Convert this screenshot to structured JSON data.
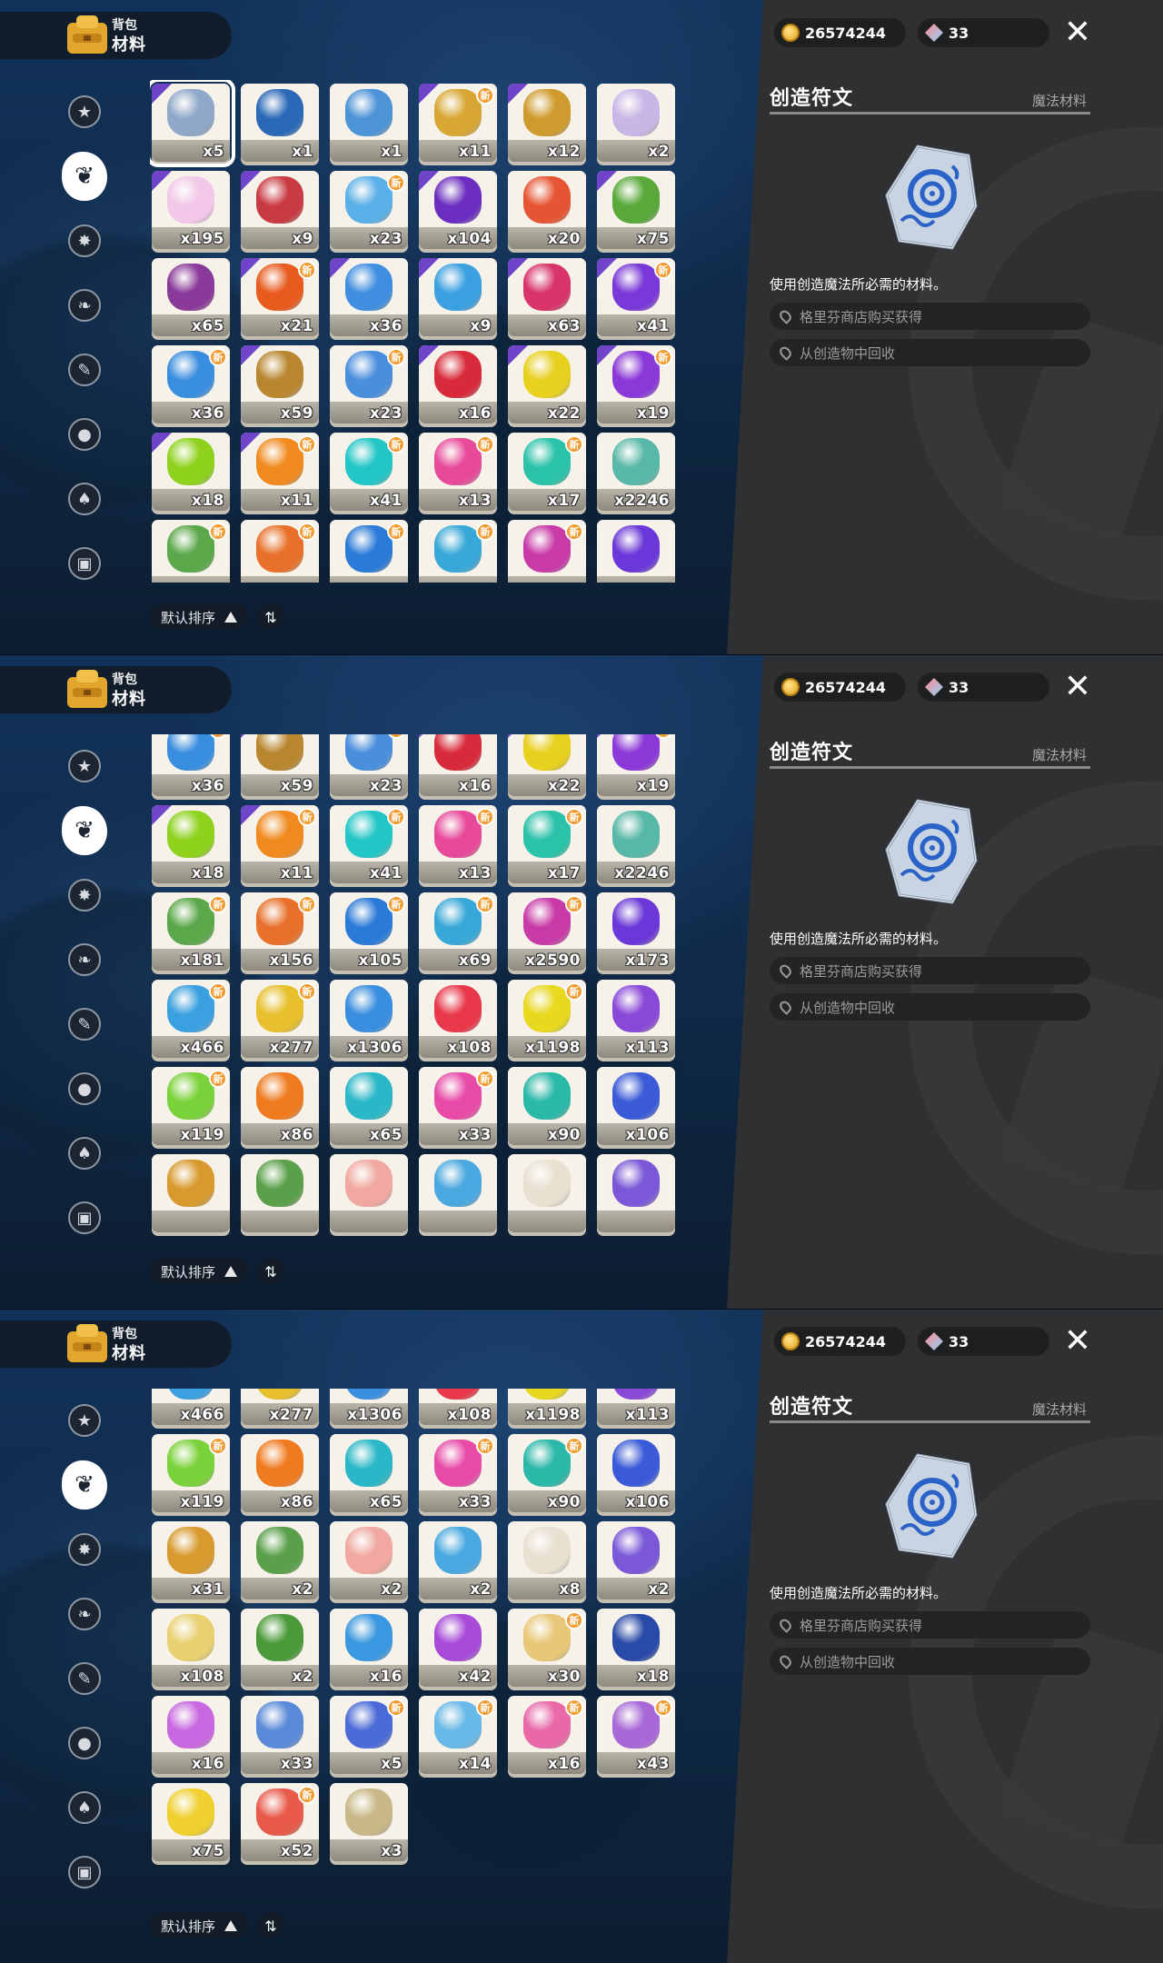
{
  "header": {
    "title_small": "背包",
    "title_big": "材料"
  },
  "currency": {
    "coins": "26574244",
    "gems": "33"
  },
  "detail": {
    "name": "创造符文",
    "category": "魔法材料",
    "description": "使用创造魔法所必需的材料。",
    "sources": [
      "格里芬商店购买获得",
      "从创造物中回收"
    ]
  },
  "sort": {
    "label": "默认排序"
  },
  "categories": [
    "star-tab",
    "material-tab",
    "magic-tab",
    "plant-tab",
    "book-tab",
    "ball-tab",
    "acorn-tab",
    "furniture-tab"
  ],
  "panels": [
    {
      "rows": [
        [
          {
            "q": "x5",
            "c": "#8fa7c8",
            "sel": true,
            "corner": true
          },
          {
            "q": "x1",
            "c": "#2a68b8"
          },
          {
            "q": "x1",
            "c": "#4d93d8"
          },
          {
            "q": "x11",
            "c": "#d8a733",
            "corner": true,
            "new": true
          },
          {
            "q": "x12",
            "c": "#cf9b2e",
            "corner": true
          },
          {
            "q": "x2",
            "c": "#c8b6e6"
          }
        ],
        [
          {
            "q": "x195",
            "c": "#f2c7e8",
            "corner": true
          },
          {
            "q": "x9",
            "c": "#c93a42",
            "corner": true
          },
          {
            "q": "x23",
            "c": "#5ab0e8",
            "new": true
          },
          {
            "q": "x104",
            "c": "#6b2ec0",
            "corner": true
          },
          {
            "q": "x20",
            "c": "#e65533"
          },
          {
            "q": "x75",
            "c": "#58a83a",
            "corner": true
          }
        ],
        [
          {
            "q": "x65",
            "c": "#8a3a9a"
          },
          {
            "q": "x21",
            "c": "#e85a1e",
            "corner": true,
            "new": true
          },
          {
            "q": "x36",
            "c": "#3f8ee0",
            "corner": true
          },
          {
            "q": "x9",
            "c": "#3aa0e0",
            "corner": true
          },
          {
            "q": "x63",
            "c": "#d8346a",
            "corner": true
          },
          {
            "q": "x41",
            "c": "#7a38d8",
            "corner": true,
            "new": true
          }
        ],
        [
          {
            "q": "x36",
            "c": "#3a8ee0",
            "new": true
          },
          {
            "q": "x59",
            "c": "#b8862e",
            "corner": true
          },
          {
            "q": "x23",
            "c": "#4a8ede",
            "new": true
          },
          {
            "q": "x16",
            "c": "#d82a3a",
            "corner": true
          },
          {
            "q": "x22",
            "c": "#e8d01e",
            "corner": true
          },
          {
            "q": "x19",
            "c": "#8a38d8",
            "corner": true,
            "new": true
          }
        ],
        [
          {
            "q": "x18",
            "c": "#8ed21e",
            "corner": true
          },
          {
            "q": "x11",
            "c": "#f08a1e",
            "corner": true,
            "new": true
          },
          {
            "q": "x41",
            "c": "#22c6c6",
            "new": true
          },
          {
            "q": "x13",
            "c": "#e84a9a",
            "new": true
          },
          {
            "q": "x17",
            "c": "#2ac2a8",
            "new": true
          },
          {
            "q": "x2246",
            "c": "#58b8a8"
          }
        ],
        [
          {
            "q": "",
            "c": "#5aa84a",
            "new": true
          },
          {
            "q": "",
            "c": "#e8702a",
            "new": true
          },
          {
            "q": "",
            "c": "#2a7ad8",
            "new": true
          },
          {
            "q": "",
            "c": "#38a8d8",
            "new": true
          },
          {
            "q": "",
            "c": "#c83aa8",
            "new": true
          },
          {
            "q": "",
            "c": "#6a38d8"
          }
        ]
      ]
    },
    {
      "rows": [
        [
          {
            "q": "x36",
            "c": "#3a8ee0",
            "new": true
          },
          {
            "q": "x59",
            "c": "#b8862e",
            "corner": true
          },
          {
            "q": "x23",
            "c": "#4a8ede",
            "new": true
          },
          {
            "q": "x16",
            "c": "#d82a3a",
            "corner": true
          },
          {
            "q": "x22",
            "c": "#e8d01e",
            "corner": true
          },
          {
            "q": "x19",
            "c": "#8a38d8",
            "corner": true,
            "new": true
          }
        ],
        [
          {
            "q": "x18",
            "c": "#8ed21e",
            "corner": true
          },
          {
            "q": "x11",
            "c": "#f08a1e",
            "corner": true,
            "new": true
          },
          {
            "q": "x41",
            "c": "#22c6c6",
            "new": true
          },
          {
            "q": "x13",
            "c": "#e84a9a",
            "new": true
          },
          {
            "q": "x17",
            "c": "#2ac2a8",
            "new": true
          },
          {
            "q": "x2246",
            "c": "#58b8a8"
          }
        ],
        [
          {
            "q": "x181",
            "c": "#5aa84a",
            "new": true
          },
          {
            "q": "x156",
            "c": "#e8702a",
            "new": true
          },
          {
            "q": "x105",
            "c": "#2a7ad8",
            "new": true
          },
          {
            "q": "x69",
            "c": "#38a8d8",
            "new": true
          },
          {
            "q": "x2590",
            "c": "#c83aa8",
            "new": true
          },
          {
            "q": "x173",
            "c": "#6a38d8"
          }
        ],
        [
          {
            "q": "x466",
            "c": "#3aa0e0",
            "new": true
          },
          {
            "q": "x277",
            "c": "#e8c02e",
            "new": true
          },
          {
            "q": "x1306",
            "c": "#3a8ee0"
          },
          {
            "q": "x108",
            "c": "#e8384a"
          },
          {
            "q": "x1198",
            "c": "#e8d81e",
            "new": true
          },
          {
            "q": "x113",
            "c": "#8a48d8"
          }
        ],
        [
          {
            "q": "x119",
            "c": "#7ad23a",
            "new": true
          },
          {
            "q": "x86",
            "c": "#f07a1e"
          },
          {
            "q": "x65",
            "c": "#2ab8c8"
          },
          {
            "q": "x33",
            "c": "#e84aa8",
            "new": true
          },
          {
            "q": "x90",
            "c": "#2ab8a8"
          },
          {
            "q": "x106",
            "c": "#3a5ad8"
          }
        ],
        [
          {
            "q": "",
            "c": "#d89a2e"
          },
          {
            "q": "",
            "c": "#5aa04a"
          },
          {
            "q": "",
            "c": "#f0a8a0"
          },
          {
            "q": "",
            "c": "#4aa8e0"
          },
          {
            "q": "",
            "c": "#e8e0d0"
          },
          {
            "q": "",
            "c": "#7a58d8"
          }
        ]
      ]
    },
    {
      "rows": [
        [
          {
            "q": "x466",
            "c": "#3aa0e0"
          },
          {
            "q": "x277",
            "c": "#e8c02e"
          },
          {
            "q": "x1306",
            "c": "#3a8ee0"
          },
          {
            "q": "x108",
            "c": "#e8384a"
          },
          {
            "q": "x1198",
            "c": "#e8d81e"
          },
          {
            "q": "x113",
            "c": "#8a48d8"
          }
        ],
        [
          {
            "q": "x119",
            "c": "#7ad23a",
            "new": true
          },
          {
            "q": "x86",
            "c": "#f07a1e"
          },
          {
            "q": "x65",
            "c": "#2ab8c8"
          },
          {
            "q": "x33",
            "c": "#e84aa8",
            "new": true
          },
          {
            "q": "x90",
            "c": "#2ab8a8",
            "new": true
          },
          {
            "q": "x106",
            "c": "#3a5ad8"
          }
        ],
        [
          {
            "q": "x31",
            "c": "#d89a2e"
          },
          {
            "q": "x2",
            "c": "#5aa04a"
          },
          {
            "q": "x2",
            "c": "#f0a8a0"
          },
          {
            "q": "x2",
            "c": "#4aa8e0"
          },
          {
            "q": "x8",
            "c": "#e8e0d0"
          },
          {
            "q": "x2",
            "c": "#7a58d8"
          }
        ],
        [
          {
            "q": "x108",
            "c": "#e8d070"
          },
          {
            "q": "x2",
            "c": "#4a9a3a"
          },
          {
            "q": "x16",
            "c": "#3a98e0"
          },
          {
            "q": "x42",
            "c": "#a84ad8"
          },
          {
            "q": "x30",
            "c": "#e8c878",
            "new": true
          },
          {
            "q": "x18",
            "c": "#2a4aa8"
          }
        ],
        [
          {
            "q": "x16",
            "c": "#c868e0"
          },
          {
            "q": "x33",
            "c": "#5a8ad8"
          },
          {
            "q": "x5",
            "c": "#4a6ad8",
            "new": true
          },
          {
            "q": "x14",
            "c": "#68b8e8",
            "new": true
          },
          {
            "q": "x16",
            "c": "#e868a8",
            "new": true
          },
          {
            "q": "x43",
            "c": "#a868d8",
            "new": true
          }
        ],
        [
          {
            "q": "x75",
            "c": "#f0d02e"
          },
          {
            "q": "x52",
            "c": "#e85a4a",
            "new": true
          },
          {
            "q": "x3",
            "c": "#c8b888"
          }
        ]
      ]
    }
  ]
}
